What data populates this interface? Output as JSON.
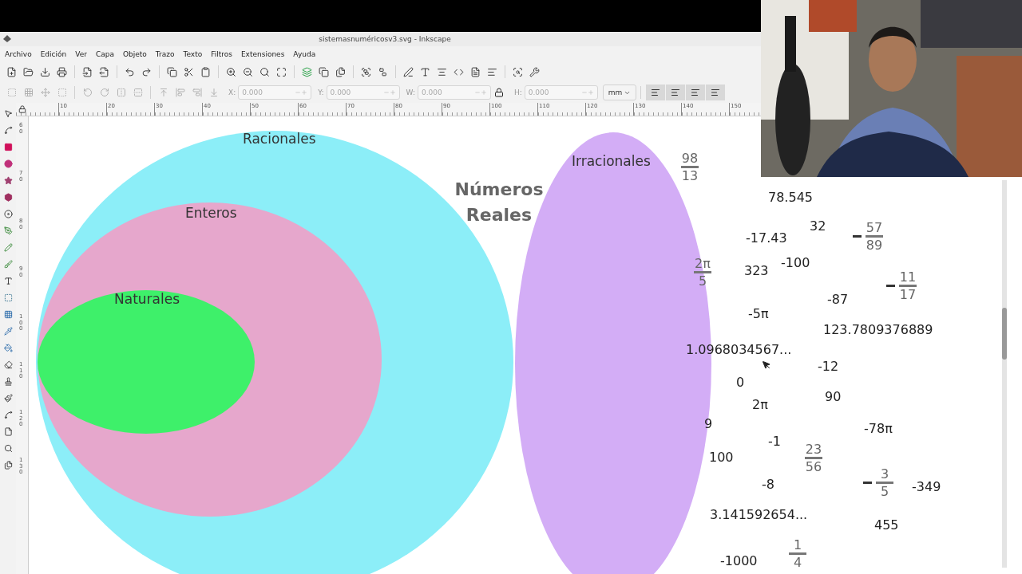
{
  "window": {
    "title": "sistemasnuméricosv3.svg - Inkscape"
  },
  "menu": [
    "Archivo",
    "Edición",
    "Ver",
    "Capa",
    "Objeto",
    "Trazo",
    "Texto",
    "Filtros",
    "Extensiones",
    "Ayuda"
  ],
  "transform_bar": {
    "fields": [
      {
        "label": "X:",
        "value": "0.000"
      },
      {
        "label": "Y:",
        "value": "0.000"
      },
      {
        "label": "W:",
        "value": "0.000"
      },
      {
        "label": "H:",
        "value": "0.000"
      }
    ],
    "unit": "mm"
  },
  "ruler": {
    "horizontal": [
      "10",
      "20",
      "30",
      "40",
      "50",
      "60",
      "70",
      "80",
      "90",
      "100",
      "110",
      "120",
      "130",
      "140",
      "150"
    ],
    "vertical": [
      "60",
      "70",
      "80",
      "90",
      "100",
      "110",
      "120",
      "130"
    ]
  },
  "canvas": {
    "title": "Números Reales",
    "sets": [
      {
        "label": "Racionales",
        "color": "#8ceef8"
      },
      {
        "label": "Enteros",
        "color": "#e6a7cc"
      },
      {
        "label": "Naturales",
        "color": "#3ef06a"
      },
      {
        "label": "Irracionales",
        "color": "#d3adf6"
      }
    ],
    "numbers": [
      {
        "kind": "fraction",
        "numerator": "98",
        "denominator": "13",
        "negative": false
      },
      {
        "kind": "number",
        "text": "78.545"
      },
      {
        "kind": "number",
        "text": "32"
      },
      {
        "kind": "number",
        "text": "-17.43"
      },
      {
        "kind": "fraction",
        "numerator": "57",
        "denominator": "89",
        "negative": true
      },
      {
        "kind": "fraction",
        "numerator": "2π",
        "denominator": "5",
        "negative": false
      },
      {
        "kind": "number",
        "text": "323"
      },
      {
        "kind": "number",
        "text": "-100"
      },
      {
        "kind": "fraction",
        "numerator": "11",
        "denominator": "17",
        "negative": true
      },
      {
        "kind": "number",
        "text": "-87"
      },
      {
        "kind": "number",
        "text": "-5π"
      },
      {
        "kind": "number",
        "text": "123.7809376889"
      },
      {
        "kind": "number",
        "text": "1.0968034567..."
      },
      {
        "kind": "number",
        "text": "-12"
      },
      {
        "kind": "number",
        "text": "0"
      },
      {
        "kind": "number",
        "text": "90"
      },
      {
        "kind": "number",
        "text": "2π"
      },
      {
        "kind": "number",
        "text": "9"
      },
      {
        "kind": "number",
        "text": "-78π"
      },
      {
        "kind": "number",
        "text": "-1"
      },
      {
        "kind": "fraction",
        "numerator": "23",
        "denominator": "56",
        "negative": false
      },
      {
        "kind": "number",
        "text": "100"
      },
      {
        "kind": "number",
        "text": "-8"
      },
      {
        "kind": "fraction",
        "numerator": "3",
        "denominator": "5",
        "negative": true
      },
      {
        "kind": "number",
        "text": "-349"
      },
      {
        "kind": "number",
        "text": "3.141592654..."
      },
      {
        "kind": "number",
        "text": "455"
      },
      {
        "kind": "number",
        "text": "-1000"
      },
      {
        "kind": "fraction",
        "numerator": "1",
        "denominator": "4",
        "negative": false
      }
    ]
  }
}
